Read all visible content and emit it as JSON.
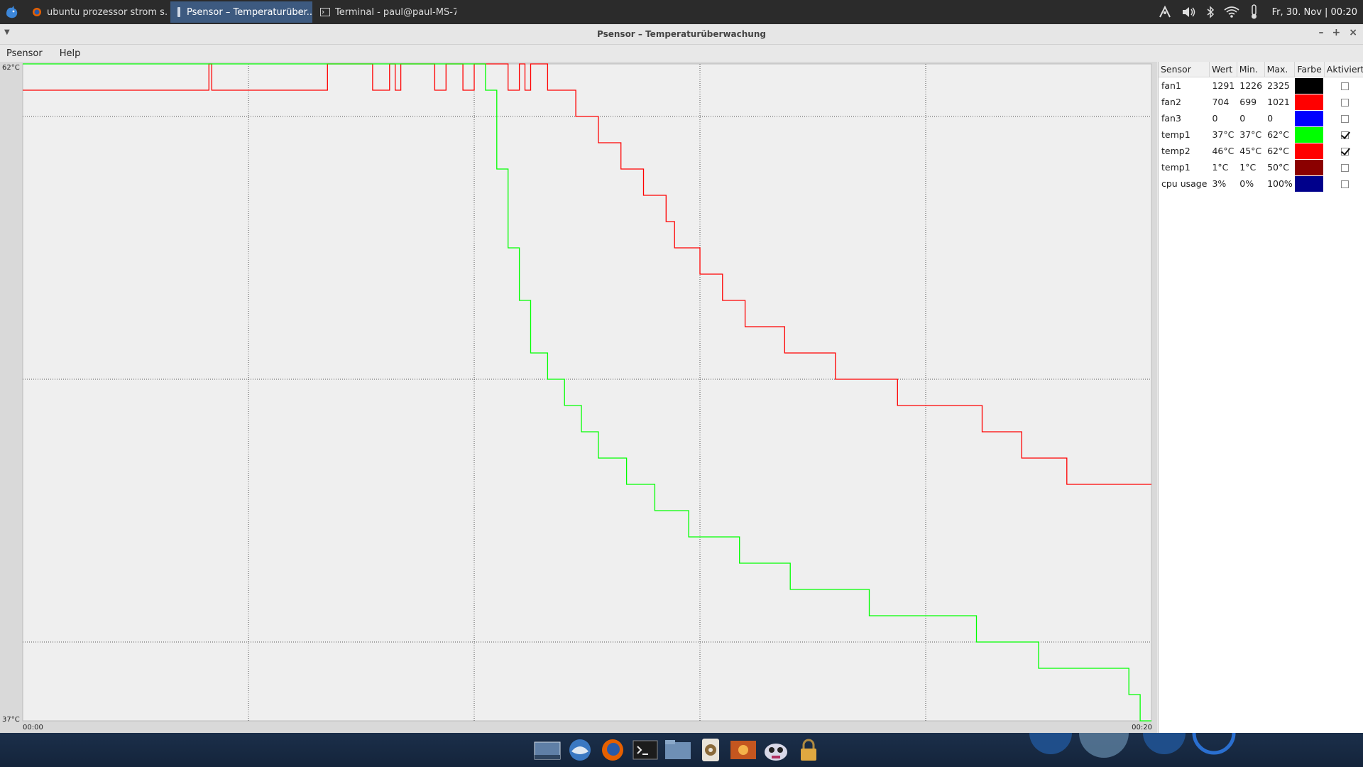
{
  "taskbar": {
    "tasks": [
      {
        "label": "ubuntu prozessor strom s...",
        "icon": "firefox-icon"
      },
      {
        "label": "Psensor – Temperaturüber...",
        "icon": "psensor-icon",
        "active": true
      },
      {
        "label": "Terminal - paul@paul-MS-7...",
        "icon": "terminal-icon"
      }
    ],
    "clock": "Fr, 30. Nov | 00:20"
  },
  "window": {
    "title": "Psensor – Temperaturüberwachung",
    "menu": [
      "Psensor",
      "Help"
    ]
  },
  "graph": {
    "y_max_label": "62°C",
    "y_min_label": "37°C",
    "x_start_label": "00:00",
    "x_end_label": "00:20"
  },
  "chart_data": {
    "type": "line",
    "ylim": [
      37,
      62
    ],
    "xlim": [
      0,
      20
    ],
    "x_unit": "minutes",
    "grid": true,
    "series": [
      {
        "name": "temp2",
        "color": "#ff0000",
        "points": [
          [
            0,
            61
          ],
          [
            3.3,
            61
          ],
          [
            3.3,
            62
          ],
          [
            3.35,
            62
          ],
          [
            3.35,
            61
          ],
          [
            5.4,
            61
          ],
          [
            5.4,
            62
          ],
          [
            6.2,
            62
          ],
          [
            6.2,
            61
          ],
          [
            6.5,
            61
          ],
          [
            6.5,
            62
          ],
          [
            6.6,
            62
          ],
          [
            6.6,
            61
          ],
          [
            6.7,
            61
          ],
          [
            6.7,
            62
          ],
          [
            7.3,
            62
          ],
          [
            7.3,
            61
          ],
          [
            7.5,
            61
          ],
          [
            7.5,
            62
          ],
          [
            7.8,
            62
          ],
          [
            7.8,
            61
          ],
          [
            8.0,
            61
          ],
          [
            8.0,
            62
          ],
          [
            8.6,
            62
          ],
          [
            8.6,
            61
          ],
          [
            8.8,
            61
          ],
          [
            8.8,
            62
          ],
          [
            8.9,
            62
          ],
          [
            8.9,
            61
          ],
          [
            9.0,
            61
          ],
          [
            9.0,
            62
          ],
          [
            9.3,
            62
          ],
          [
            9.3,
            61
          ],
          [
            9.8,
            61
          ],
          [
            9.8,
            60
          ],
          [
            10.2,
            60
          ],
          [
            10.2,
            59
          ],
          [
            10.6,
            59
          ],
          [
            10.6,
            58
          ],
          [
            11.0,
            58
          ],
          [
            11.0,
            57
          ],
          [
            11.4,
            57
          ],
          [
            11.4,
            56
          ],
          [
            11.55,
            56
          ],
          [
            11.55,
            55
          ],
          [
            12.0,
            55
          ],
          [
            12.0,
            54
          ],
          [
            12.4,
            54
          ],
          [
            12.4,
            53
          ],
          [
            12.8,
            53
          ],
          [
            12.8,
            52
          ],
          [
            13.5,
            52
          ],
          [
            13.5,
            51
          ],
          [
            14.4,
            51
          ],
          [
            14.4,
            50
          ],
          [
            15.5,
            50
          ],
          [
            15.5,
            49
          ],
          [
            17.0,
            49
          ],
          [
            17.0,
            48
          ],
          [
            17.7,
            48
          ],
          [
            17.7,
            47
          ],
          [
            18.5,
            47
          ],
          [
            18.5,
            46
          ],
          [
            20,
            46
          ]
        ]
      },
      {
        "name": "temp1",
        "color": "#00ff00",
        "points": [
          [
            0,
            62
          ],
          [
            8.2,
            62
          ],
          [
            8.2,
            61
          ],
          [
            8.4,
            61
          ],
          [
            8.4,
            58
          ],
          [
            8.6,
            58
          ],
          [
            8.6,
            55
          ],
          [
            8.8,
            55
          ],
          [
            8.8,
            53
          ],
          [
            9.0,
            53
          ],
          [
            9.0,
            51
          ],
          [
            9.3,
            51
          ],
          [
            9.3,
            50
          ],
          [
            9.6,
            50
          ],
          [
            9.6,
            49
          ],
          [
            9.9,
            49
          ],
          [
            9.9,
            48
          ],
          [
            10.2,
            48
          ],
          [
            10.2,
            47
          ],
          [
            10.7,
            47
          ],
          [
            10.7,
            46
          ],
          [
            11.2,
            46
          ],
          [
            11.2,
            45
          ],
          [
            11.8,
            45
          ],
          [
            11.8,
            44
          ],
          [
            12.7,
            44
          ],
          [
            12.7,
            43
          ],
          [
            13.6,
            43
          ],
          [
            13.6,
            42
          ],
          [
            15.0,
            42
          ],
          [
            15.0,
            41
          ],
          [
            16.9,
            41
          ],
          [
            16.9,
            40
          ],
          [
            18.0,
            40
          ],
          [
            18.0,
            39
          ],
          [
            19.6,
            39
          ],
          [
            19.6,
            38
          ],
          [
            19.8,
            38
          ],
          [
            19.8,
            37
          ],
          [
            20,
            37
          ]
        ]
      }
    ]
  },
  "sensors": {
    "headers": [
      "Sensor",
      "Wert",
      "Min.",
      "Max.",
      "Farbe",
      "Aktiviert"
    ],
    "rows": [
      {
        "name": "fan1",
        "value": "1291",
        "min": "1226",
        "max": "2325",
        "color": "#000000",
        "enabled": false
      },
      {
        "name": "fan2",
        "value": "704",
        "min": "699",
        "max": "1021",
        "color": "#ff0000",
        "enabled": false
      },
      {
        "name": "fan3",
        "value": "0",
        "min": "0",
        "max": "0",
        "color": "#0000ff",
        "enabled": false
      },
      {
        "name": "temp1",
        "value": "37°C",
        "min": "37°C",
        "max": "62°C",
        "color": "#00ff00",
        "enabled": true
      },
      {
        "name": "temp2",
        "value": "46°C",
        "min": "45°C",
        "max": "62°C",
        "color": "#ff0000",
        "enabled": true
      },
      {
        "name": "temp1",
        "value": "1°C",
        "min": "1°C",
        "max": "50°C",
        "color": "#8b0000",
        "enabled": false
      },
      {
        "name": "cpu usage",
        "value": "3%",
        "min": "0%",
        "max": "100%",
        "color": "#00008b",
        "enabled": false
      }
    ]
  },
  "dock": [
    "desktop-icon",
    "thunderbird-icon",
    "firefox-icon",
    "terminal-icon",
    "file-manager-icon",
    "media-player-icon",
    "photo-viewer-icon",
    "game-icon",
    "lock-icon"
  ]
}
